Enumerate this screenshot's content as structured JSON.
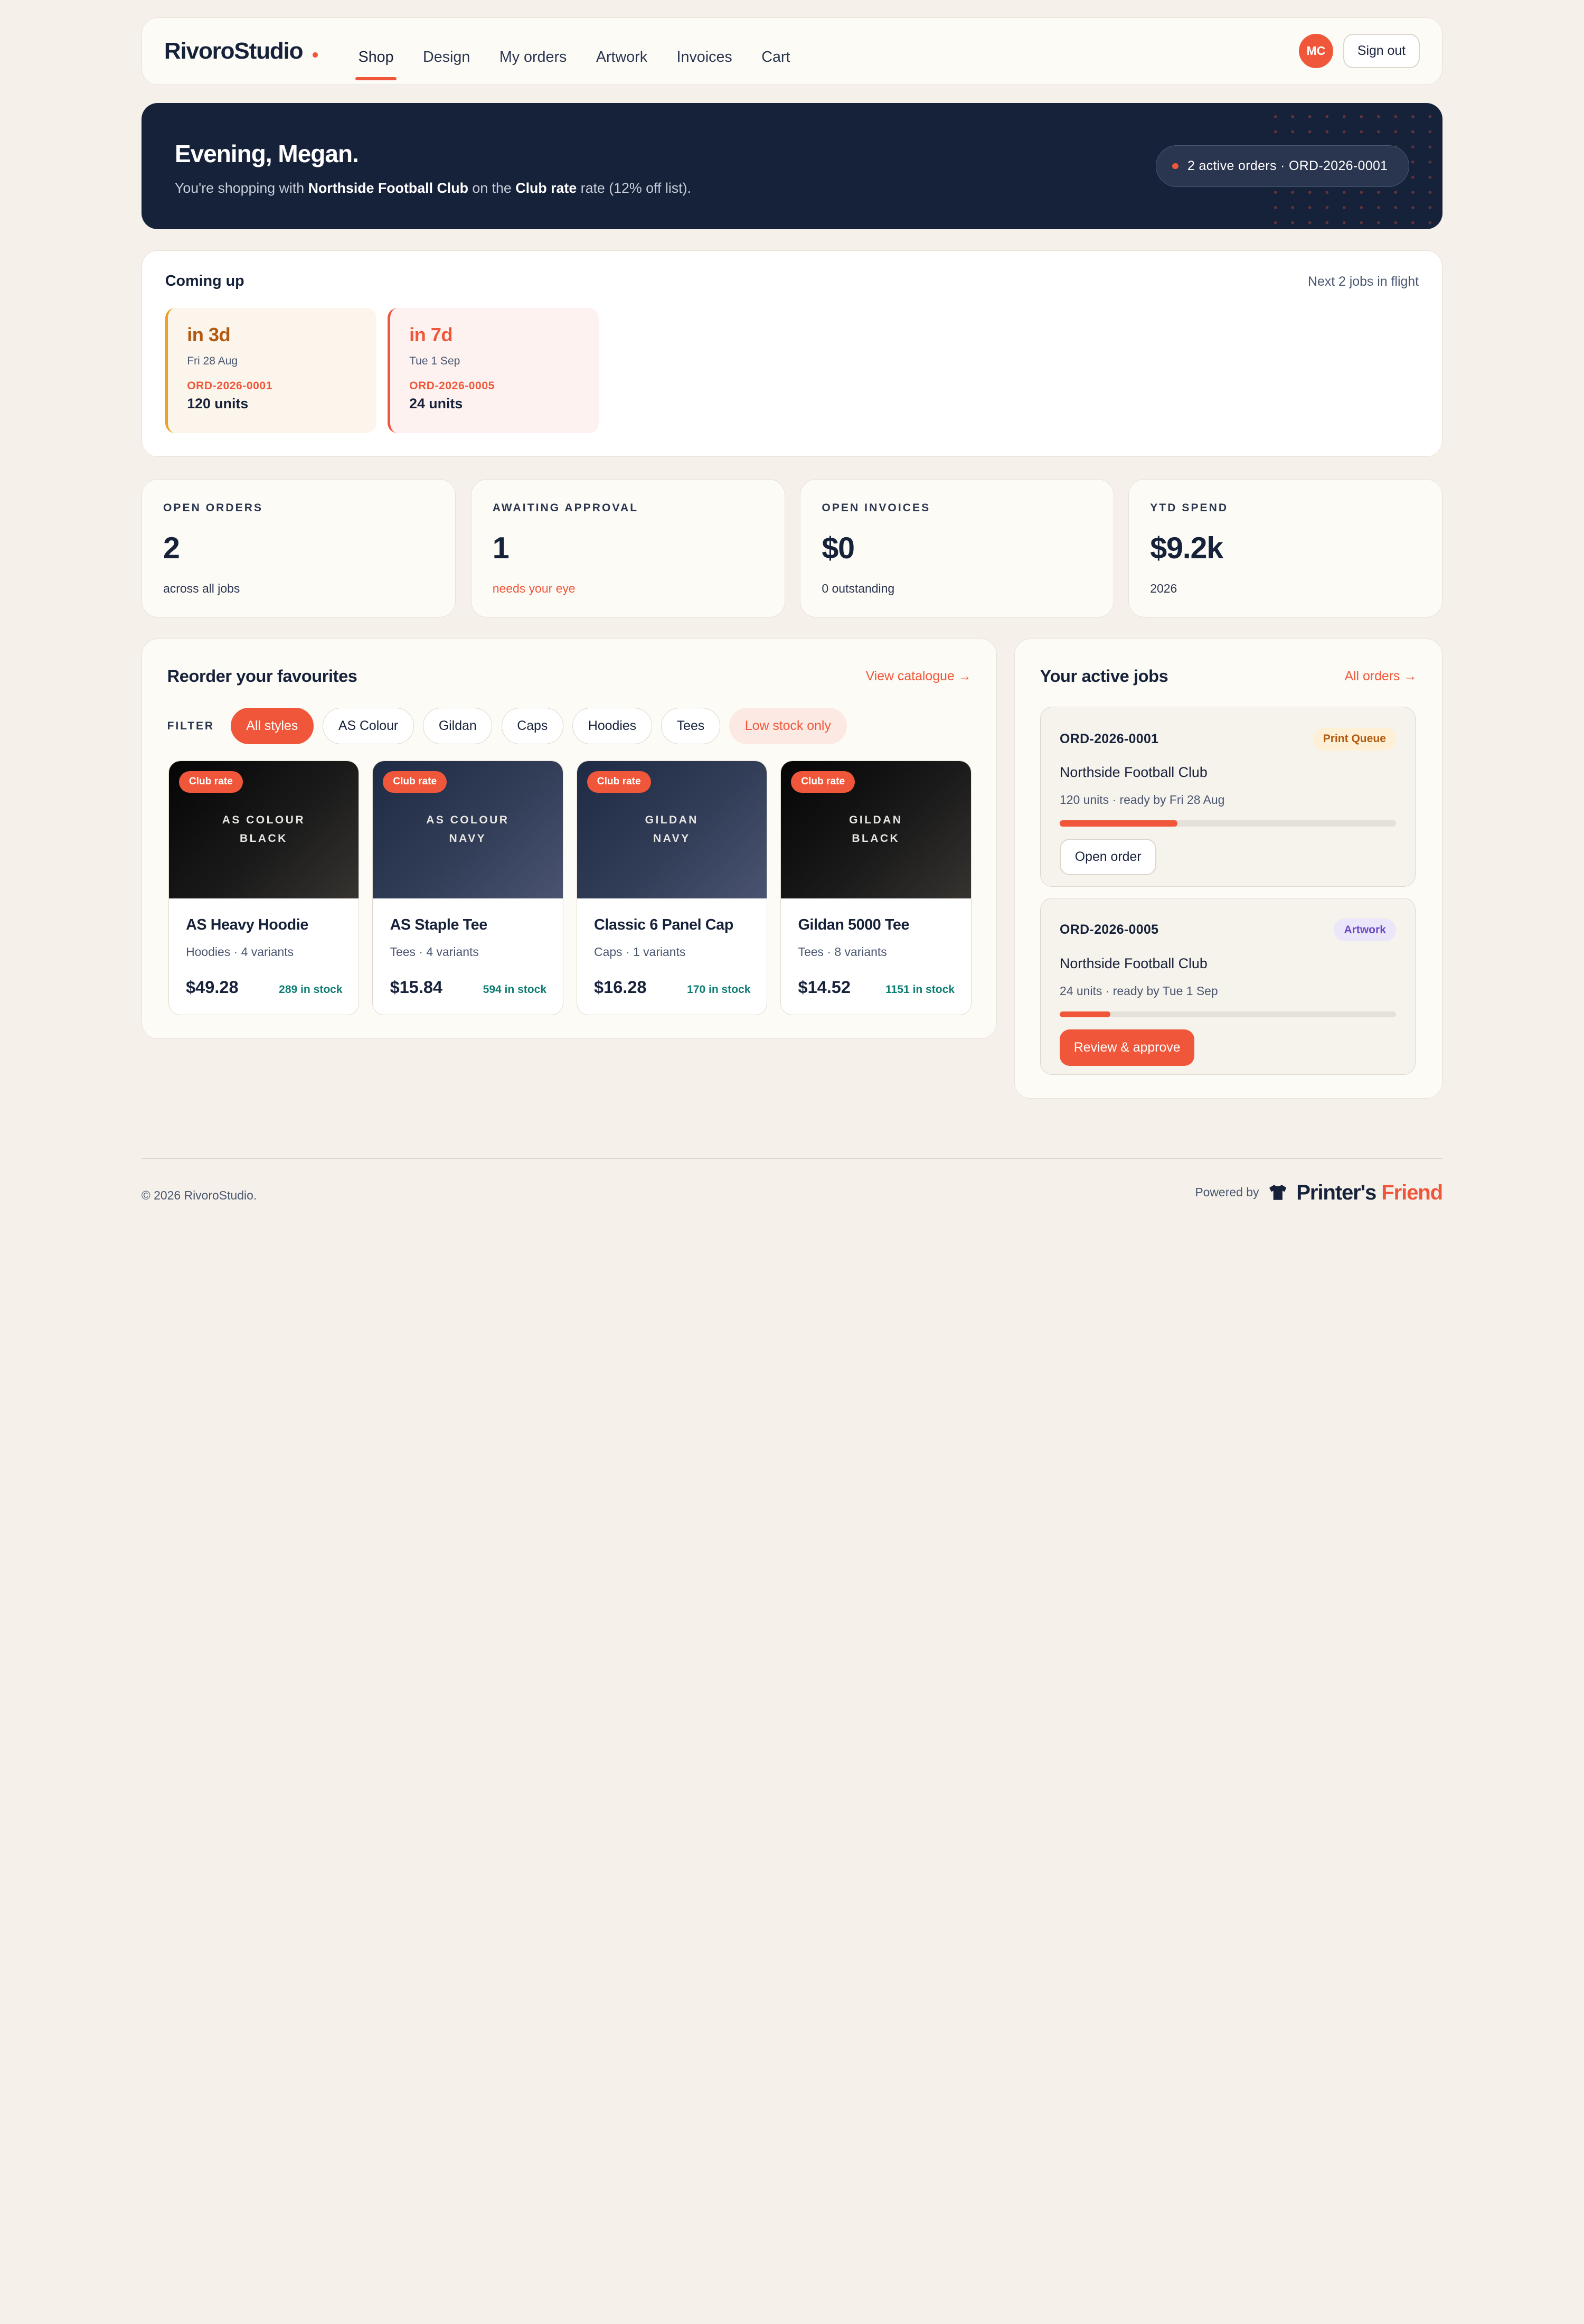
{
  "nav": {
    "brand": "RivoroStudio",
    "links": [
      "Shop",
      "Design",
      "My orders",
      "Artwork",
      "Invoices",
      "Cart"
    ],
    "active_link": "Shop",
    "avatar_initials": "MC",
    "sign_out": "Sign out"
  },
  "hero": {
    "greeting": "Evening, Megan.",
    "sub_prefix": "You're shopping with ",
    "club": "Northside Football Club",
    "sub_mid": " on the ",
    "rate": "Club rate",
    "sub_suffix": " rate (12% off list).",
    "pill": "2 active orders · ORD-2026-0001"
  },
  "coming_up": {
    "title": "Coming up",
    "meta": "Next 2 jobs in flight",
    "tiles": [
      {
        "when": "in 3d",
        "date": "Fri 28 Aug",
        "order": "ORD-2026-0001",
        "units": "120 units"
      },
      {
        "when": "in 7d",
        "date": "Tue 1 Sep",
        "order": "ORD-2026-0005",
        "units": "24 units"
      }
    ]
  },
  "stats": [
    {
      "label": "OPEN ORDERS",
      "value": "2",
      "note": "across all jobs"
    },
    {
      "label": "AWAITING APPROVAL",
      "value": "1",
      "note": "needs your eye"
    },
    {
      "label": "OPEN INVOICES",
      "value": "$0",
      "note": "0 outstanding"
    },
    {
      "label": "YTD SPEND",
      "value": "$9.2k",
      "note": "2026"
    }
  ],
  "reorder": {
    "title": "Reorder your favourites",
    "link": "View catalogue →",
    "filter_label": "FILTER",
    "filters": [
      "All styles",
      "AS Colour",
      "Gildan",
      "Caps",
      "Hoodies",
      "Tees",
      "Low stock only"
    ],
    "active_filter": "All styles",
    "products": [
      {
        "badge": "Club rate",
        "img_line1": "AS COLOUR",
        "img_line2": "BLACK",
        "name": "AS Heavy Hoodie",
        "meta": "Hoodies · 4 variants",
        "price": "$49.28",
        "stock": "289 in stock"
      },
      {
        "badge": "Club rate",
        "img_line1": "AS COLOUR",
        "img_line2": "NAVY",
        "name": "AS Staple Tee",
        "meta": "Tees · 4 variants",
        "price": "$15.84",
        "stock": "594 in stock"
      },
      {
        "badge": "Club rate",
        "img_line1": "GILDAN",
        "img_line2": "NAVY",
        "name": "Classic 6 Panel Cap",
        "meta": "Caps · 1 variants",
        "price": "$16.28",
        "stock": "170 in stock"
      },
      {
        "badge": "Club rate",
        "img_line1": "GILDAN",
        "img_line2": "BLACK",
        "name": "Gildan 5000 Tee",
        "meta": "Tees · 8 variants",
        "price": "$14.52",
        "stock": "1151 in stock"
      }
    ]
  },
  "active_jobs": {
    "title": "Your active jobs",
    "link": "All orders →",
    "jobs": [
      {
        "id": "ORD-2026-0001",
        "status": "Print Queue",
        "club": "Northside Football Club",
        "detail": "120 units · ready by Fri 28 Aug",
        "progress": 0.35,
        "action": "Open order"
      },
      {
        "id": "ORD-2026-0005",
        "status": "Artwork",
        "club": "Northside Football Club",
        "detail": "24 units · ready by Tue 1 Sep",
        "progress": 0.15,
        "action": "Review & approve"
      }
    ]
  },
  "footer": {
    "copyright": "© 2026 RivoroStudio.",
    "powered_by": "Powered by",
    "partner_part1": "Printer's",
    "partner_part2": "Friend"
  },
  "colors": {
    "accent": "#f0573a",
    "navy": "#16213a",
    "background": "#f5f1ea",
    "stock_green": "#0f7d72"
  }
}
